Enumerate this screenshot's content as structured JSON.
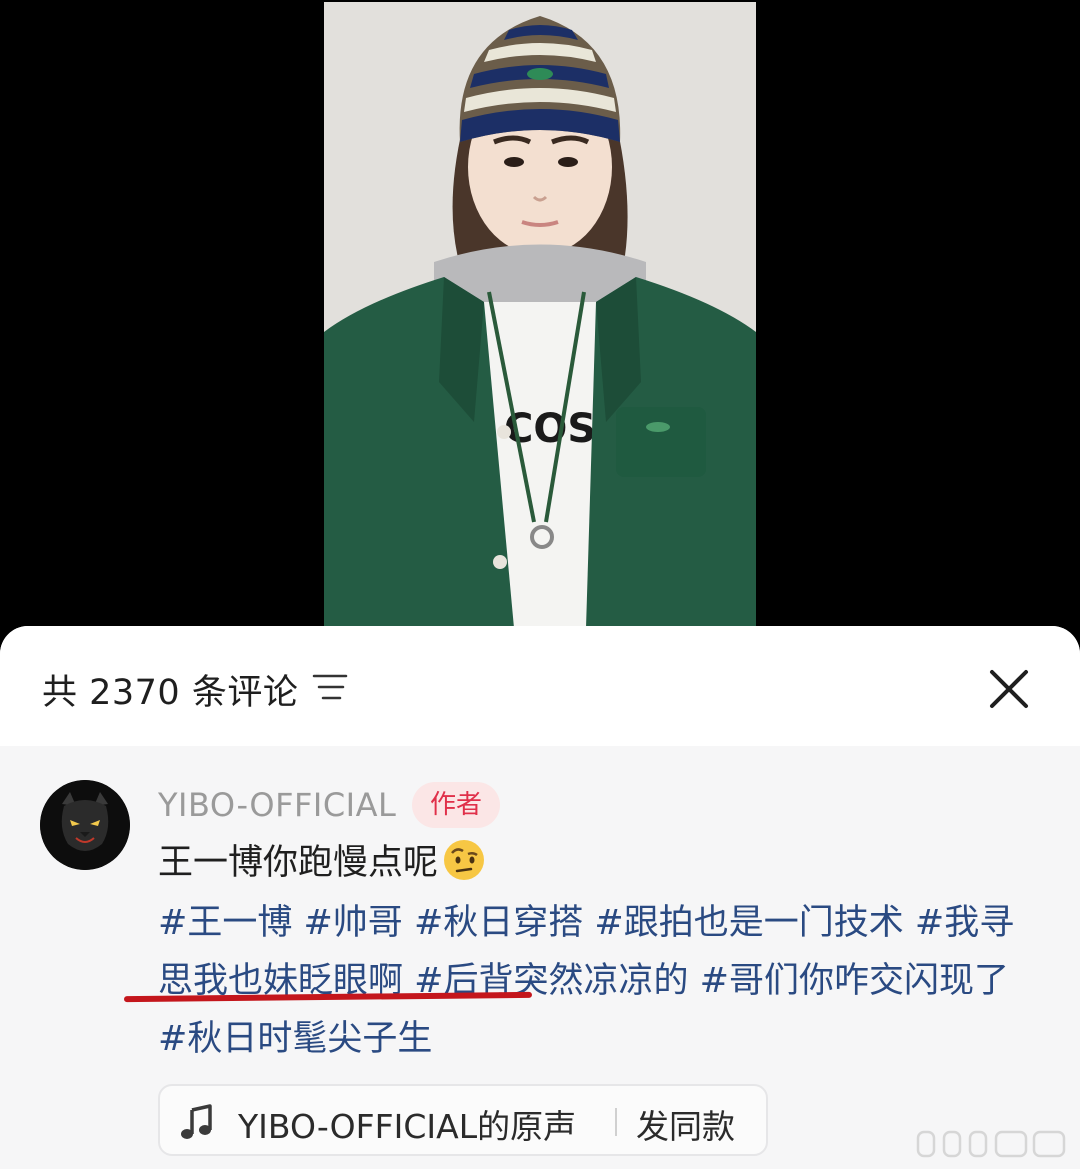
{
  "comments": {
    "count_label": "共 2370 条评论",
    "filter_icon": "sort-lines-icon",
    "close_icon": "close-x-icon"
  },
  "comment": {
    "username": "YIBO-OFFICIAL",
    "badge": "作者",
    "text": "王一博你跑慢点呢",
    "emoji": "raised-eyebrow-face",
    "hashtags": [
      "#王一博",
      "#帅哥",
      "#秋日穿搭",
      "#跟拍也是一门技术",
      "#我寻思我也妹眨眼啊",
      "#后背突然凉凉的",
      "#哥们你咋交闪现了",
      "#秋日时髦尖子生"
    ]
  },
  "sound": {
    "icon": "music-note-icon",
    "label": "YIBO-OFFICIAL的原声",
    "action": "发同款"
  },
  "colors": {
    "hashtag": "#2a4a82",
    "badge_text": "#e0304a",
    "badge_bg": "#fbe6e6",
    "underline": "#c4161c"
  }
}
